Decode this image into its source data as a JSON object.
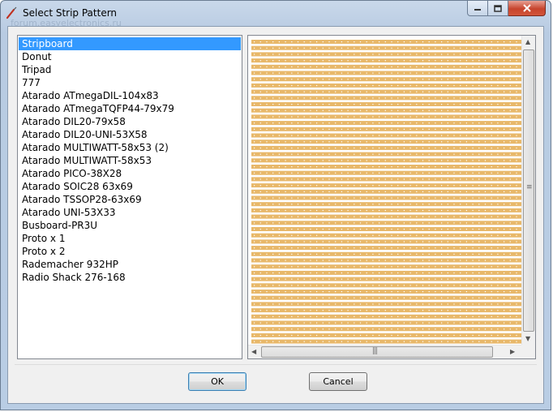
{
  "window": {
    "title": "Select Strip Pattern",
    "watermark": "forum.easyelectronics.ru"
  },
  "patterns": [
    "Stripboard",
    "Donut",
    "Tripad",
    "777",
    "Atarado ATmegaDIL-104x83",
    "Atarado ATmegaTQFP44-79x79",
    "Atarado DIL20-79x58",
    "Atarado DIL20-UNI-53X58",
    "Atarado MULTIWATT-58x53 (2)",
    "Atarado MULTIWATT-58x53",
    "Atarado PICO-38X28",
    "Atarado SOIC28 63x69",
    "Atarado TSSOP28-63x69",
    "Atarado UNI-53X33",
    "Busboard-PR3U",
    "Proto x 1",
    "Proto x 2",
    "Rademacher 932HP",
    "Radio Shack 276-168"
  ],
  "selected_pattern": "Stripboard",
  "buttons": {
    "ok": "OK",
    "cancel": "Cancel"
  },
  "colors": {
    "strip": "#e8b86a",
    "hole": "#ffffff",
    "selection": "#3399ff"
  }
}
